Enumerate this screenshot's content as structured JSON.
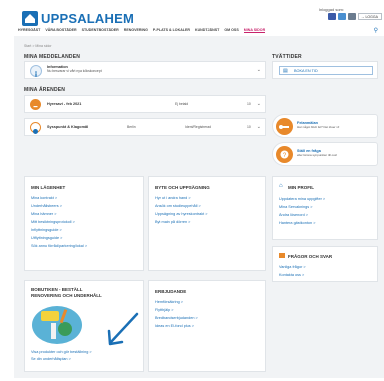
{
  "header": {
    "logo_text": "UPPSALAHEM",
    "logged_in_label": "Inloggad som:",
    "login_label": "→ LOGGA",
    "nav": [
      "HYRESGÄST",
      "VÅRA BOSTÄDER",
      "STUDENTBOSTÄDER",
      "RENOVERING",
      "P-PLATS & LOKALER",
      "KUNDTJÄNST",
      "OM OSS",
      "MINA SIDOR"
    ],
    "nav_active_index": 7
  },
  "breadcrumb": "Start > Mina sidor",
  "messages": {
    "title": "MINA MEDDELANDEN",
    "item_title": "Information",
    "item_sub": "Nu besvarar vi vårt nya kökskoncept"
  },
  "tvattider": {
    "title": "TVÄTTIDER",
    "button": "BOKA EN TID"
  },
  "arenden": {
    "title": "MINA ÄRENDEN",
    "rows": [
      {
        "name": "Hyresavi - feb 2021",
        "status": "Ej betald",
        "extra": "",
        "count": "10"
      },
      {
        "name": "Sysspunkt & Klagomål",
        "status": "Berlin",
        "extra": "Ident/Registrerad",
        "count": "10"
      }
    ]
  },
  "cards": [
    {
      "title": "Felanmälan",
      "sub": "Har något blivit fel? Det löser vi!"
    },
    {
      "title": "Ställ en fråga",
      "sub": "eller lämna synpunkter till oss!"
    }
  ],
  "lagenhet": {
    "title": "MIN LÄGENHET",
    "links": [
      "Mina kontrakt >",
      "Underhållsbeers >",
      "Mina hämner >",
      "Mitt besiktningsprotokoll >",
      "Inflyttningsguide >",
      "Utflyttningsguide >",
      "Sök annu förråd/parkering/lokal >"
    ]
  },
  "byte": {
    "title": "BYTE OCH UPPSÄGNING",
    "links": [
      "Hyr ut i andra hand >",
      "Ansök om studieuppehåll >",
      "Uppsägning av hyreskontrakt >",
      "Byt main på dörren >"
    ]
  },
  "profil": {
    "title": "MIN PROFIL",
    "links": [
      "Uppdatera mina uppgifter >",
      "Mina Servaknings >",
      "Ändra lösenord >",
      "Hantera gästkonton >"
    ]
  },
  "fragor": {
    "title": "FRÅGOR OCH SVAR",
    "links": [
      "Vanliga frågor >",
      "Kontakta oss >"
    ]
  },
  "bobutiken": {
    "title_line1": "BOBUTIKEN - BESTÄLL",
    "title_line2": "RENOVERING OCH UNDERHÅLL",
    "links": [
      "Visa produkter och gör beställning >",
      "Se din underhållsplan >"
    ]
  },
  "erbjudande": {
    "title": "ERBJUDANDE",
    "links": [
      "Hemförsäkring >",
      "Flytthjälp >",
      "Bredbandserbjudanden >",
      "Ideas en El-fond plus >"
    ]
  },
  "colors": {
    "brand": "#1a6fb5",
    "accent": "#c8226b",
    "orange": "#e8892b",
    "arrow": "#1a6fb5"
  }
}
